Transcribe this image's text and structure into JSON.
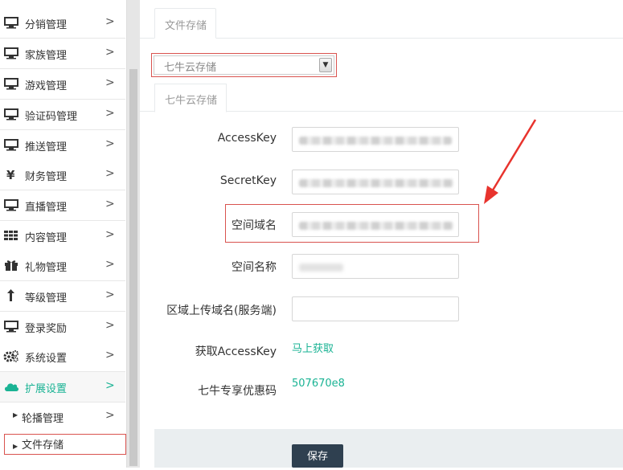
{
  "sidebar": {
    "items": [
      {
        "label": "分销管理",
        "icon": "monitor-icon"
      },
      {
        "label": "家族管理",
        "icon": "monitor-icon"
      },
      {
        "label": "游戏管理",
        "icon": "monitor-icon"
      },
      {
        "label": "验证码管理",
        "icon": "monitor-icon"
      },
      {
        "label": "推送管理",
        "icon": "monitor-icon"
      },
      {
        "label": "财务管理",
        "icon": "yen-icon"
      },
      {
        "label": "直播管理",
        "icon": "monitor-icon"
      },
      {
        "label": "内容管理",
        "icon": "grid-icon"
      },
      {
        "label": "礼物管理",
        "icon": "gift-icon"
      },
      {
        "label": "等级管理",
        "icon": "level-up-icon"
      },
      {
        "label": "登录奖励",
        "icon": "monitor-icon"
      },
      {
        "label": "系统设置",
        "icon": "gears-icon"
      },
      {
        "label": "扩展设置",
        "icon": "cloud-icon"
      }
    ],
    "chevron": ">",
    "subitems": [
      {
        "label": "轮播管理"
      },
      {
        "label": "文件存储"
      }
    ]
  },
  "main": {
    "tab": "文件存储",
    "storage_select": {
      "value": "七牛云存储"
    },
    "subtab": "七牛云存储",
    "fields": {
      "access_key": {
        "label": "AccessKey"
      },
      "secret_key": {
        "label": "SecretKey"
      },
      "space_domain": {
        "label": "空间域名"
      },
      "space_name": {
        "label": "空间名称"
      },
      "upload_domain": {
        "label": "区域上传域名(服务端)",
        "value": ""
      }
    },
    "get_access_key": {
      "label": "获取AccessKey",
      "link": "马上获取"
    },
    "coupon": {
      "label": "七牛专享优惠码",
      "code": "507670e8"
    },
    "save_label": "保存"
  },
  "colors": {
    "accent": "#1ab394",
    "highlight": "#d9534f",
    "dark": "#2f4050"
  }
}
